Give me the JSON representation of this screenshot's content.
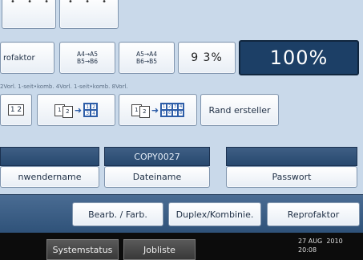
{
  "top_row": {
    "dots": "• • •"
  },
  "ratio_row": {
    "zoom_label": "rofaktor",
    "preset1": {
      "line1": "A4→A5",
      "line2": "B5→B6"
    },
    "preset2": {
      "line1": "A5→A4",
      "line2": "B6→B5"
    },
    "current_percent": "9 3%",
    "full_size": "100%"
  },
  "combine_hint": "2Vorl. 1-seit•komb. 4Vorl. 1-seit•komb. 8Vorl.",
  "combine_buttons": {
    "partial_label": "1 2",
    "create_margin": "Rand ersteller"
  },
  "file_panel": {
    "doc_name_value": "COPY0027",
    "user_name_label": "nwendername",
    "file_name_label": "Dateiname",
    "password_label": "Passwort"
  },
  "actions": {
    "edit_color": "Bearb. / Farb.",
    "duplex_combine": "Duplex/Kombinie.",
    "reproduction_ratio": "Reprofaktor"
  },
  "status_bar": {
    "system_status": "Systemstatus",
    "job_list": "Jobliste",
    "date": "27 AUG  2010",
    "time": "20:08"
  },
  "colors": {
    "background": "#c9d9ea",
    "accent_dark": "#1c3f66",
    "panel_bar": "#27486f",
    "status_bar": "#0c0c0c"
  }
}
